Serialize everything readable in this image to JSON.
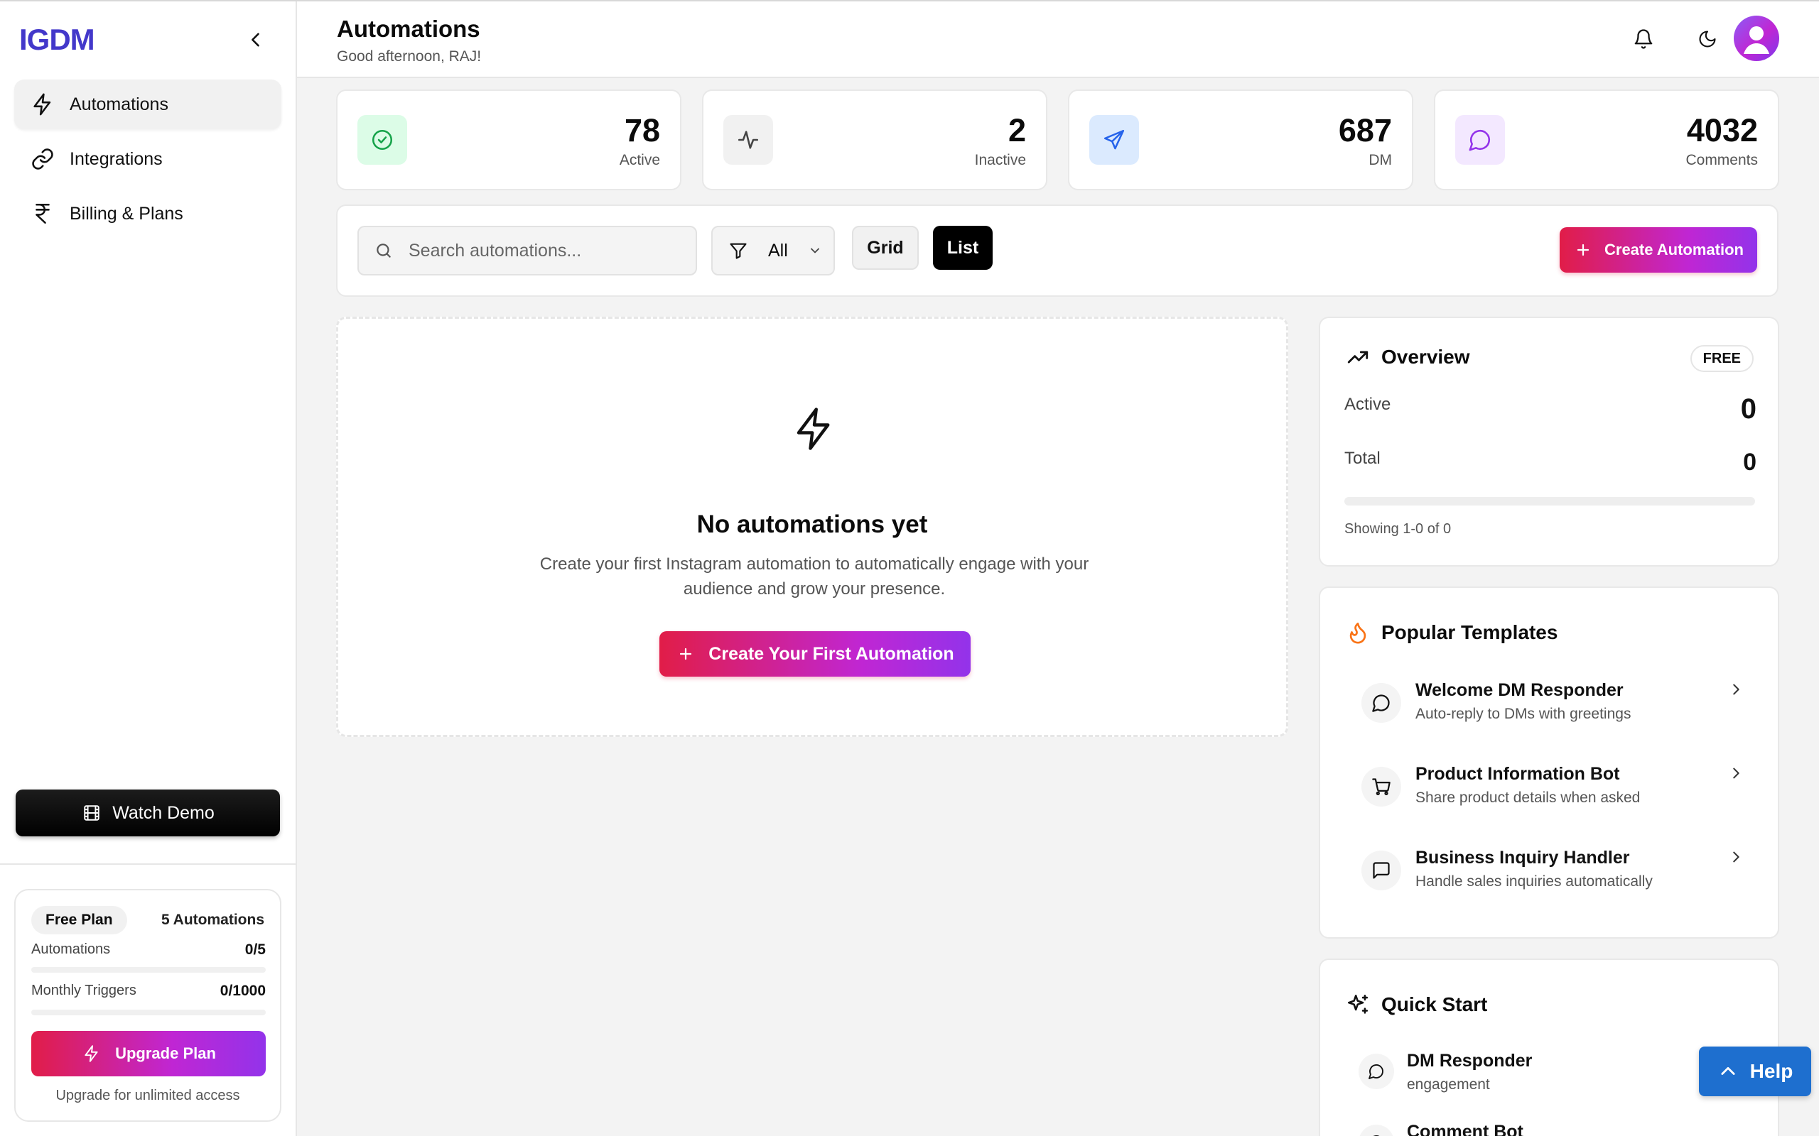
{
  "app": {
    "logo": "IGDM"
  },
  "sidebar": {
    "items": [
      {
        "label": "Automations",
        "icon": "zap-icon",
        "active": true
      },
      {
        "label": "Integrations",
        "icon": "link-icon"
      },
      {
        "label": "Billing & Plans",
        "icon": "rupee-icon"
      }
    ],
    "watch_demo": "Watch Demo",
    "plan": {
      "name": "Free Plan",
      "limit_label": "5 Automations",
      "automations_label": "Automations",
      "automations_value": "0/5",
      "automations_fraction": 0,
      "triggers_label": "Monthly Triggers",
      "triggers_value": "0/1000",
      "triggers_fraction": 0,
      "upgrade_label": "Upgrade Plan",
      "upgrade_note": "Upgrade for unlimited access"
    }
  },
  "header": {
    "title": "Automations",
    "greeting": "Good afternoon, RAJ!"
  },
  "stats": [
    {
      "value": "78",
      "label": "Active",
      "icon": "check-circle-icon",
      "color": "#16a34a",
      "bg": "#dcfce7"
    },
    {
      "value": "2",
      "label": "Inactive",
      "icon": "activity-icon",
      "color": "#444444",
      "bg": "#f1f1f1"
    },
    {
      "value": "687",
      "label": "DM",
      "icon": "send-icon",
      "color": "#2563eb",
      "bg": "#dbeafe"
    },
    {
      "value": "4032",
      "label": "Comments",
      "icon": "message-circle-icon",
      "color": "#9333ea",
      "bg": "#f3e8ff"
    }
  ],
  "toolbar": {
    "search_placeholder": "Search automations...",
    "filter_value": "All",
    "grid_label": "Grid",
    "list_label": "List",
    "active_view": "List",
    "create_label": "Create Automation"
  },
  "empty_state": {
    "title": "No automations yet",
    "description": "Create your first Instagram automation to automatically engage with your audience and grow your presence.",
    "button": "Create Your First Automation"
  },
  "overview": {
    "title": "Overview",
    "badge": "FREE",
    "active_label": "Active",
    "active_value": "0",
    "total_label": "Total",
    "total_value": "0",
    "progress_fraction": 0,
    "showing": "Showing 1-0 of 0"
  },
  "templates": {
    "title": "Popular Templates",
    "items": [
      {
        "name": "Welcome DM Responder",
        "desc": "Auto-reply to DMs with greetings",
        "icon": "message-circle-icon"
      },
      {
        "name": "Product Information Bot",
        "desc": "Share product details when asked",
        "icon": "cart-icon"
      },
      {
        "name": "Business Inquiry Handler",
        "desc": "Handle sales inquiries automatically",
        "icon": "message-square-icon"
      }
    ]
  },
  "quick_start": {
    "title": "Quick Start",
    "items": [
      {
        "name": "DM Responder",
        "desc": "engagement",
        "icon": "message-circle-icon"
      },
      {
        "name": "Comment Bot",
        "desc": "",
        "icon": "message-circle-icon"
      }
    ]
  },
  "help": {
    "label": "Help"
  },
  "colors": {
    "accent_start": "#e11d48",
    "accent_end": "#9333ea",
    "logo": "#4338ca",
    "help": "#1e6fcf"
  }
}
